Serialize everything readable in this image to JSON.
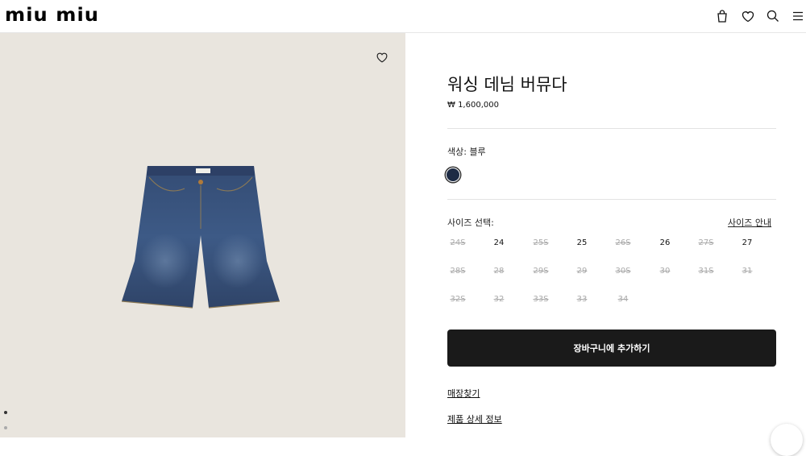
{
  "header": {
    "logo": "miu miu",
    "icons": [
      "bag-icon",
      "heart-icon",
      "search-icon",
      "menu-icon"
    ]
  },
  "gallery": {
    "image": "denim-shorts-image",
    "background": "#e9e5de",
    "wishlist_icon": "heart-icon",
    "dots": 2
  },
  "product": {
    "title": "워싱 데님 버뮤다",
    "price": "₩ 1,600,000",
    "color_label": "색상:  블루",
    "swatch_color": "#1d2b44",
    "size_label": "사이즈 선택:",
    "size_guide": "사이즈 안내",
    "sizes": [
      {
        "label": "24S",
        "available": false
      },
      {
        "label": "24",
        "available": true
      },
      {
        "label": "25S",
        "available": false
      },
      {
        "label": "25",
        "available": true
      },
      {
        "label": "26S",
        "available": false
      },
      {
        "label": "26",
        "available": true
      },
      {
        "label": "27S",
        "available": false
      },
      {
        "label": "27",
        "available": true
      },
      {
        "label": "28S",
        "available": false
      },
      {
        "label": "28",
        "available": false
      },
      {
        "label": "29S",
        "available": false
      },
      {
        "label": "29",
        "available": false
      },
      {
        "label": "30S",
        "available": false
      },
      {
        "label": "30",
        "available": false
      },
      {
        "label": "31S",
        "available": false
      },
      {
        "label": "31",
        "available": false
      },
      {
        "label": "32S",
        "available": false
      },
      {
        "label": "32",
        "available": false
      },
      {
        "label": "33S",
        "available": false
      },
      {
        "label": "33",
        "available": false
      },
      {
        "label": "34",
        "available": false
      }
    ],
    "add_to_cart": "장바구니에 추가하기",
    "store_finder": "매장찾기",
    "product_details": "제품 상세 정보"
  }
}
